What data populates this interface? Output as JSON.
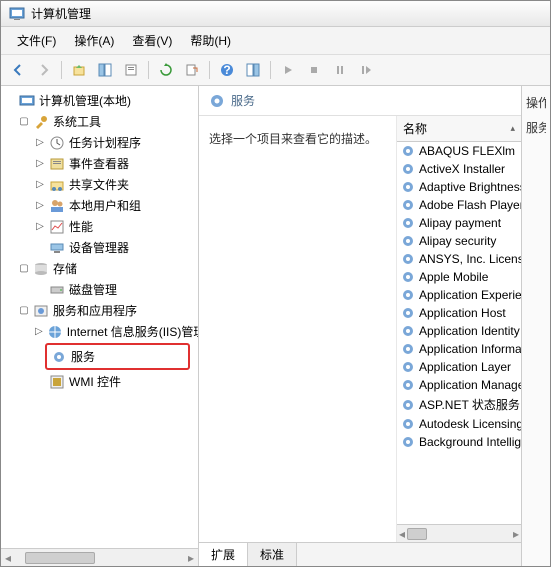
{
  "title": "计算机管理",
  "menubar": {
    "file": "文件(F)",
    "action": "操作(A)",
    "view": "查看(V)",
    "help": "帮助(H)"
  },
  "tree": {
    "root": "计算机管理(本地)",
    "system_tools": "系统工具",
    "task_scheduler": "任务计划程序",
    "event_viewer": "事件查看器",
    "shared_folders": "共享文件夹",
    "local_users": "本地用户和组",
    "performance": "性能",
    "device_manager": "设备管理器",
    "storage": "存储",
    "disk_management": "磁盘管理",
    "services_apps": "服务和应用程序",
    "iis": "Internet 信息服务(IIS)管理器",
    "services": "服务",
    "wmi": "WMI 控件"
  },
  "center": {
    "heading": "服务",
    "description": "选择一个项目来查看它的描述。",
    "name_col": "名称",
    "tabs": {
      "extended": "扩展",
      "standard": "标准"
    }
  },
  "rightpane": {
    "actions": "操作",
    "services": "服务"
  },
  "services": [
    "ABAQUS FLEXlm",
    "ActiveX Installer",
    "Adaptive Brightness",
    "Adobe Flash Player",
    "Alipay payment",
    "Alipay security",
    "ANSYS, Inc. License",
    "Apple Mobile",
    "Application Experience",
    "Application Host",
    "Application Identity",
    "Application Information",
    "Application Layer",
    "Application Management",
    "ASP.NET 状态服务",
    "Autodesk Licensing",
    "Background Intelligent"
  ]
}
